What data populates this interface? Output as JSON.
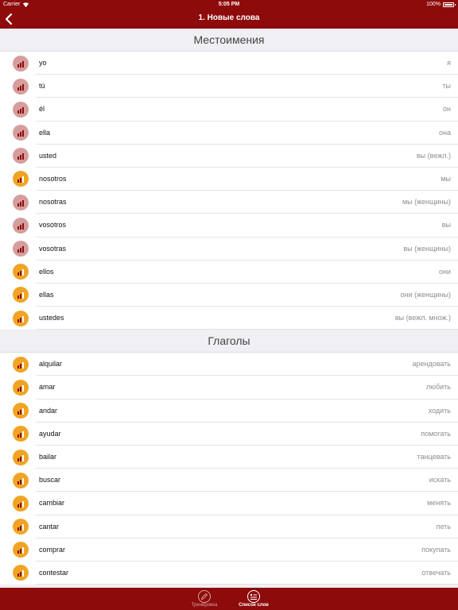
{
  "status_bar": {
    "carrier": "Carrier",
    "time": "5:05 PM",
    "battery": "100%"
  },
  "nav": {
    "title": "1. Новые слова",
    "back_icon": "chevron-left-icon"
  },
  "colors": {
    "brand": "#8e0b0b",
    "level_low": "#d69d9d",
    "level_mid": "#f0a426"
  },
  "sections": [
    {
      "title": "Местоимения",
      "items": [
        {
          "es": "yo",
          "ru": "я",
          "level": "pink"
        },
        {
          "es": "tú",
          "ru": "ты",
          "level": "pink"
        },
        {
          "es": "él",
          "ru": "он",
          "level": "pink"
        },
        {
          "es": "ella",
          "ru": "она",
          "level": "pink"
        },
        {
          "es": "usted",
          "ru": "вы (вежл.)",
          "level": "pink"
        },
        {
          "es": "nosotros",
          "ru": "мы",
          "level": "orange"
        },
        {
          "es": "nosotras",
          "ru": "мы (женщины)",
          "level": "pink"
        },
        {
          "es": "vosotros",
          "ru": "вы",
          "level": "pink"
        },
        {
          "es": "vosotras",
          "ru": "вы (женщины)",
          "level": "pink"
        },
        {
          "es": "ellos",
          "ru": "они",
          "level": "orange"
        },
        {
          "es": "ellas",
          "ru": "они (женщины)",
          "level": "orange"
        },
        {
          "es": "ustedes",
          "ru": "вы (вежл. множ.)",
          "level": "orange"
        }
      ]
    },
    {
      "title": "Глаголы",
      "items": [
        {
          "es": "alquilar",
          "ru": "арендовать",
          "level": "orange"
        },
        {
          "es": "amar",
          "ru": "любить",
          "level": "orange"
        },
        {
          "es": "andar",
          "ru": "ходить",
          "level": "orange"
        },
        {
          "es": "ayudar",
          "ru": "помогать",
          "level": "orange"
        },
        {
          "es": "bailar",
          "ru": "танцевать",
          "level": "orange"
        },
        {
          "es": "buscar",
          "ru": "искать",
          "level": "orange"
        },
        {
          "es": "cambiar",
          "ru": "менять",
          "level": "orange"
        },
        {
          "es": "cantar",
          "ru": "петь",
          "level": "orange"
        },
        {
          "es": "comprar",
          "ru": "покупать",
          "level": "orange"
        },
        {
          "es": "contestar",
          "ru": "отвечать",
          "level": "orange"
        }
      ]
    }
  ],
  "tabs": [
    {
      "label": "Тренировка",
      "icon": "pencil-circle-icon",
      "active": false
    },
    {
      "label": "Список слов",
      "icon": "list-circle-icon",
      "active": true
    }
  ]
}
